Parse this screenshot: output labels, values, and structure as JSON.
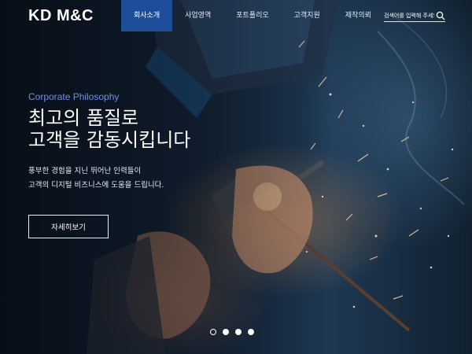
{
  "header": {
    "logo": "KD M&C",
    "nav": [
      {
        "label": "회사소개",
        "active": true
      },
      {
        "label": "사업영역",
        "active": false
      },
      {
        "label": "포트폴리오",
        "active": false
      },
      {
        "label": "고객지원",
        "active": false
      },
      {
        "label": "제작의뢰",
        "active": false
      }
    ],
    "search": {
      "placeholder": "검색어를 입력해 주세요.",
      "icon": "search-icon"
    }
  },
  "hero": {
    "subtitle": "Corporate Philosophy",
    "headline_line1": "최고의 품질로",
    "headline_line2": "고객을 감동시킵니다",
    "desc_line1": "풍부한 경험을 지닌 뛰어난 인력들이",
    "desc_line2": "고객의 디지털 비즈니스에 도움을 드립니다.",
    "cta_label": "자세히보기"
  },
  "slider": {
    "count": 4,
    "active_index": 0
  },
  "colors": {
    "nav_active": "#1e4d9a",
    "subtitle": "#6f8fe3"
  }
}
